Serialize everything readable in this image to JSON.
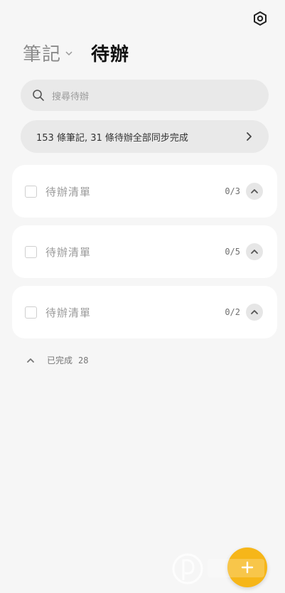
{
  "header": {
    "notes_tab": "筆記",
    "todos_tab": "待辦"
  },
  "search": {
    "placeholder": "搜尋待辦"
  },
  "sync": {
    "status": "153 條筆記, 31 條待辦全部同步完成"
  },
  "todo_lists": [
    {
      "title": "待辦清單",
      "count": "0/3"
    },
    {
      "title": "待辦清單",
      "count": "0/5"
    },
    {
      "title": "待辦清單",
      "count": "0/2"
    }
  ],
  "completed": {
    "label": "已完成",
    "count": "28"
  },
  "colors": {
    "background": "#f6f6f6",
    "card": "#ffffff",
    "pill": "#e9e9e9",
    "accent": "#f6b619"
  },
  "icons": {
    "settings": "settings-hexagon-icon",
    "search": "search-icon",
    "sync_arrow": "chevron-right-icon",
    "collapse": "chevron-up-icon",
    "add": "add-icon"
  }
}
